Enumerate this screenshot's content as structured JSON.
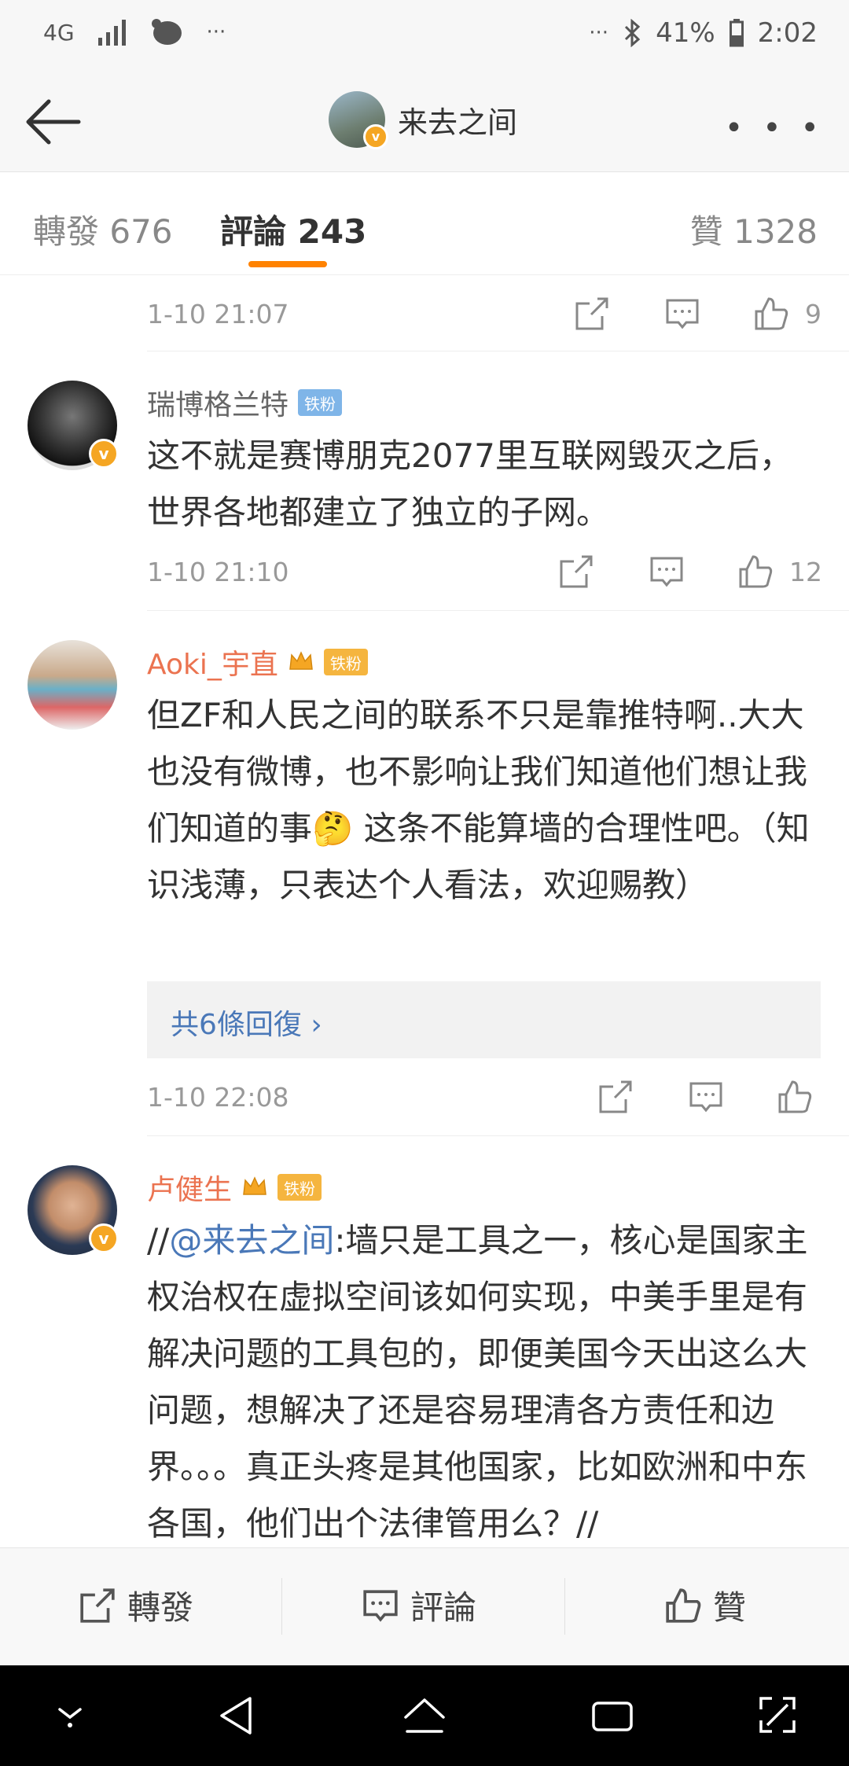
{
  "status_bar": {
    "network": "4G",
    "battery": "41%",
    "time": "2:02",
    "dots": "···"
  },
  "header": {
    "title": "来去之间",
    "verified_mark": "v",
    "more_label": "• • •"
  },
  "tabs": [
    {
      "label": "轉發 676"
    },
    {
      "label": "評論 243"
    },
    {
      "label": "贊 1328"
    }
  ],
  "accent_color": "#ff8200",
  "comments": [
    {
      "time": "1-10 21:07",
      "likes": "9"
    },
    {
      "name": "瑞博格兰特",
      "badge": "铁粉",
      "text": "这不就是赛博朋克2077里互联网毁灭之后，世界各地都建立了独立的子网。",
      "time": "1-10 21:10",
      "likes": "12"
    },
    {
      "name": "Aoki_宇直",
      "badge": "铁粉",
      "text_a": "但ZF和人民之间的联系不只是靠推特啊..大大也没有微博，也不影响让我们知道他们想让我们知道的事",
      "emoji": "🤔",
      "text_b": " 这条不能算墙的合理性吧。（知识浅薄，只表达个人看法，欢迎赐教）",
      "replies": "共6條回復 ›",
      "time": "1-10 22:08",
      "likes": ""
    },
    {
      "name": "卢健生",
      "badge": "铁粉",
      "prefix": "//",
      "mention": "@来去之间",
      "text": ":墙只是工具之一，核心是国家主权治权在虚拟空间该如何实现，中美手里是有解决问题的工具包的，即便美国今天出这么大问题，想解决了还是容易理清各方责任和边界。。。真正头疼是其他国家，比如欧洲和中东各国，他们出个法律管用么？//"
    }
  ],
  "bottom_bar": {
    "repost": "轉發",
    "comment": "評論",
    "like": "贊"
  }
}
